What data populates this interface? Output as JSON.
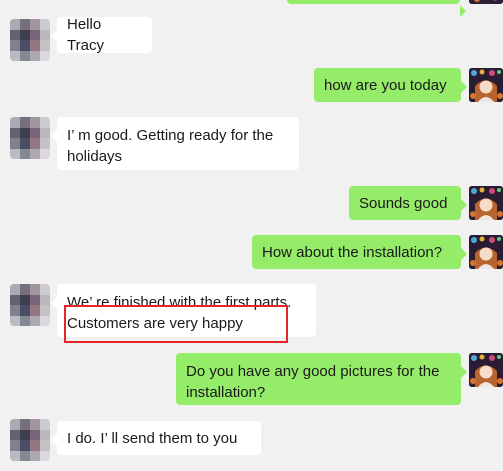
{
  "messages": [
    {
      "direction": "out",
      "text": ""
    },
    {
      "direction": "in",
      "text": "Hello Tracy"
    },
    {
      "direction": "out",
      "text": "how are you today"
    },
    {
      "direction": "in",
      "lines": [
        "I’ m good. Getting ready for the",
        "holidays"
      ]
    },
    {
      "direction": "out",
      "text": "Sounds good"
    },
    {
      "direction": "out",
      "text": "How about the installation?"
    },
    {
      "direction": "in",
      "lines": [
        "We’ re finished with the first parts.",
        "Customers are very happy"
      ]
    },
    {
      "direction": "out",
      "lines": [
        "Do you have any good pictures for the",
        "installation?"
      ]
    },
    {
      "direction": "in",
      "text": "I do. I’ ll send them to you"
    }
  ],
  "colors": {
    "background": "#f1f1f1",
    "outgoing_bubble": "#95ec69",
    "incoming_bubble": "#ffffff",
    "highlight_box": "#e4262b"
  },
  "icons": {
    "incoming_avatar": "pixelated-avatar-icon",
    "outgoing_avatar": "user-photo-avatar-icon"
  }
}
